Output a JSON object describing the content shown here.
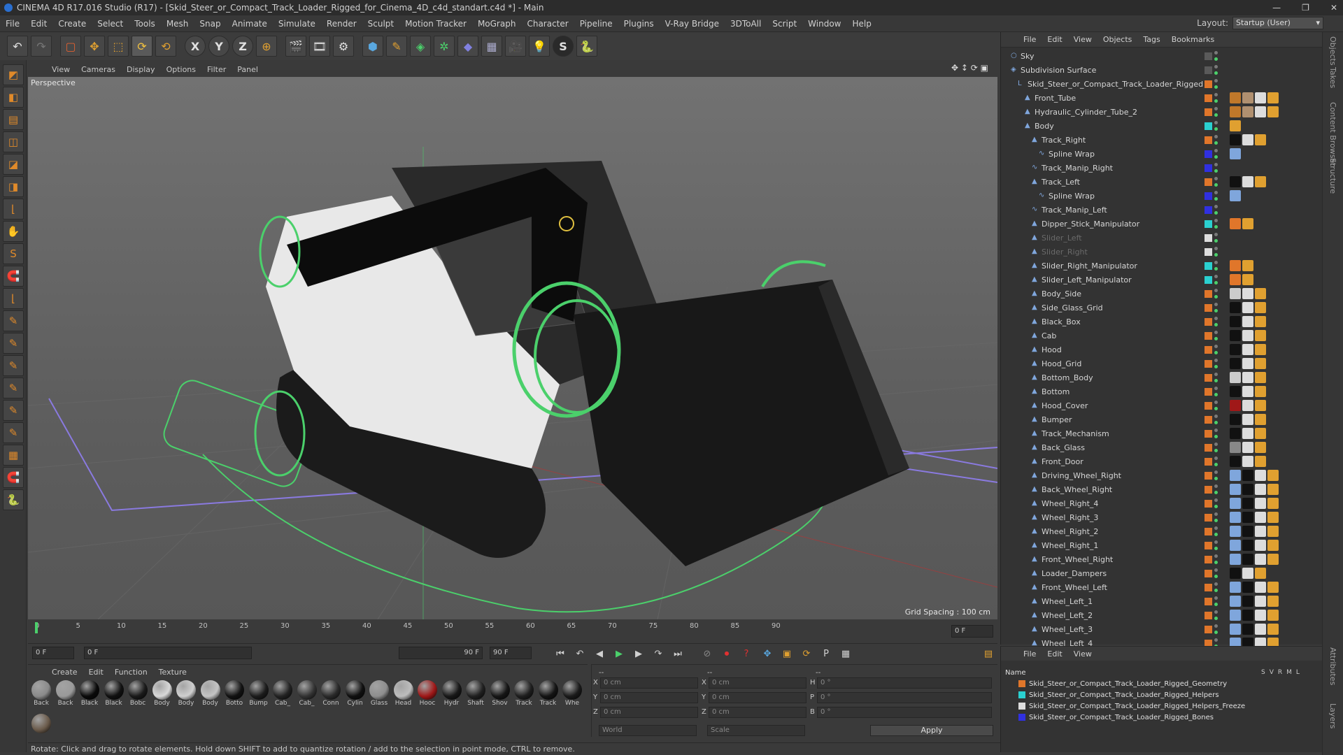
{
  "window": {
    "title": "CINEMA 4D R17.016 Studio (R17) - [Skid_Steer_or_Compact_Track_Loader_Rigged_for_Cinema_4D_c4d_standart.c4d *] - Main",
    "min": "—",
    "max": "❐",
    "close": "✕"
  },
  "menubar": [
    "File",
    "Edit",
    "Create",
    "Select",
    "Tools",
    "Mesh",
    "Snap",
    "Animate",
    "Simulate",
    "Render",
    "Sculpt",
    "Motion Tracker",
    "MoGraph",
    "Character",
    "Pipeline",
    "Plugins",
    "V-Ray Bridge",
    "3DToAll",
    "Script",
    "Window",
    "Help"
  ],
  "layout": {
    "label": "Layout:",
    "value": "Startup (User)"
  },
  "toolbar": {
    "undo": "↶",
    "redo": "↷",
    "live_select": "▢",
    "move": "✥",
    "scale": "⬚",
    "rotate": "⟳",
    "recent": "⟲",
    "x_axis": "X",
    "y_axis": "Y",
    "z_axis": "Z",
    "world": "⊕",
    "render_view": "🎬",
    "render_pv": "🎞",
    "render_settings": "⚙",
    "cube": "⬢",
    "pen": "✎",
    "subdiv": "◈",
    "cloner": "✲",
    "deformer": "◆",
    "floor": "▦",
    "camera": "🎥",
    "light": "💡",
    "s_plugin": "S",
    "python": "🐍"
  },
  "left_tools": [
    "◩",
    "◧",
    "▤",
    "◫",
    "◪",
    "◨",
    "⌊",
    "✋",
    "S",
    "🧲",
    "⌊",
    "✎",
    "✎",
    "✎",
    "✎",
    "✎",
    "✎",
    "▦",
    "🧲",
    "🐍"
  ],
  "viewport": {
    "menu": [
      "View",
      "Cameras",
      "Display",
      "Options",
      "Filter",
      "Panel"
    ],
    "label": "Perspective",
    "grid_spacing": "Grid Spacing : 100 cm",
    "nav_icons": "✥ ↕ ⟳ ▣"
  },
  "timeline": {
    "ticks": [
      "0",
      "5",
      "10",
      "15",
      "20",
      "25",
      "30",
      "35",
      "40",
      "45",
      "50",
      "55",
      "60",
      "65",
      "70",
      "75",
      "80",
      "85",
      "90"
    ],
    "current": "0 F"
  },
  "transport": {
    "start": "0 F",
    "range_start": "0 F",
    "range_end": "90 F",
    "end": "90 F"
  },
  "material_manager": {
    "menu": [
      "Create",
      "Edit",
      "Function",
      "Texture"
    ],
    "materials": [
      {
        "name": "Back",
        "color": "#8a8a8a"
      },
      {
        "name": "Back",
        "color": "#9a9a9a"
      },
      {
        "name": "Black",
        "color": "#0a0a0a"
      },
      {
        "name": "Black",
        "color": "#111"
      },
      {
        "name": "Bobc",
        "color": "#1a1a1a"
      },
      {
        "name": "Body",
        "color": "#d8d8d8"
      },
      {
        "name": "Body",
        "color": "#cfcfcf"
      },
      {
        "name": "Body",
        "color": "#c4c4c4"
      },
      {
        "name": "Botto",
        "color": "#121212"
      },
      {
        "name": "Bump",
        "color": "#1c1c1c"
      },
      {
        "name": "Cab_",
        "color": "#222"
      },
      {
        "name": "Cab_",
        "color": "#333"
      },
      {
        "name": "Conn",
        "color": "#2a2a2a"
      },
      {
        "name": "Cylin",
        "color": "#101010"
      },
      {
        "name": "Glass",
        "color": "#8e8e8e"
      },
      {
        "name": "Head",
        "color": "#bdbdbd"
      },
      {
        "name": "Hooc",
        "color": "#a01818"
      },
      {
        "name": "Hydr",
        "color": "#181818"
      },
      {
        "name": "Shaft",
        "color": "#202020"
      },
      {
        "name": "Shov",
        "color": "#161616"
      },
      {
        "name": "Track",
        "color": "#1e1e1e"
      },
      {
        "name": "Track",
        "color": "#141414"
      },
      {
        "name": "Whe",
        "color": "#1a1a1a"
      }
    ],
    "extra_material": {
      "name": "",
      "color": "#6a5a4a"
    }
  },
  "coords": {
    "header_dashes": [
      "--",
      "--",
      "--"
    ],
    "rows": [
      {
        "axis": "X",
        "pos": "0 cm",
        "axis2": "X",
        "size": "0 cm",
        "rot_axis": "H",
        "rot": "0 °"
      },
      {
        "axis": "Y",
        "pos": "0 cm",
        "axis2": "Y",
        "size": "0 cm",
        "rot_axis": "P",
        "rot": "0 °"
      },
      {
        "axis": "Z",
        "pos": "0 cm",
        "axis2": "Z",
        "size": "0 cm",
        "rot_axis": "B",
        "rot": "0 °"
      }
    ],
    "mode1": "World",
    "mode2": "Scale",
    "apply": "Apply"
  },
  "status": "Rotate: Click and drag to rotate elements. Hold down SHIFT to add to quantize rotation / add to the selection in point mode, CTRL to remove.",
  "object_manager": {
    "menu": [
      "File",
      "Edit",
      "View",
      "Objects",
      "Tags",
      "Bookmarks"
    ],
    "objects": [
      {
        "name": "Sky",
        "indent": 0,
        "icon": "○",
        "layer": "#5a5a5a",
        "dim": false,
        "tags": []
      },
      {
        "name": "Subdivision Surface",
        "indent": 0,
        "icon": "◈",
        "layer": "#5a5a5a",
        "dim": false,
        "tags": []
      },
      {
        "name": "Skid_Steer_or_Compact_Track_Loader_Rigged",
        "indent": 1,
        "icon": "L",
        "layer": "#e0762a",
        "dim": false,
        "tags": []
      },
      {
        "name": "Front_Tube",
        "indent": 2,
        "icon": "▲",
        "layer": "#e0762a",
        "dim": false,
        "tags": [
          "#c0782a",
          "#b09070",
          "#ddd",
          "#e0a030"
        ]
      },
      {
        "name": "Hydraulic_Cylinder_Tube_2",
        "indent": 2,
        "icon": "▲",
        "layer": "#e0762a",
        "dim": false,
        "tags": [
          "#c0782a",
          "#b09070",
          "#ddd",
          "#e0a030"
        ]
      },
      {
        "name": "Body",
        "indent": 2,
        "icon": "▲",
        "layer": "#2ad0d0",
        "dim": false,
        "tags": [
          "#e0a030"
        ]
      },
      {
        "name": "Track_Right",
        "indent": 3,
        "icon": "▲",
        "layer": "#e0762a",
        "dim": false,
        "tags": [
          "#111",
          "#ddd",
          "#e0a030"
        ]
      },
      {
        "name": "Spline Wrap",
        "indent": 4,
        "icon": "∿",
        "layer": "#3030e0",
        "dim": false,
        "tags": [
          "#7fa6dc"
        ]
      },
      {
        "name": "Track_Manip_Right",
        "indent": 3,
        "icon": "∿",
        "layer": "#3030e0",
        "dim": false,
        "tags": []
      },
      {
        "name": "Track_Left",
        "indent": 3,
        "icon": "▲",
        "layer": "#e0762a",
        "dim": false,
        "tags": [
          "#111",
          "#ddd",
          "#e0a030"
        ]
      },
      {
        "name": "Spline Wrap",
        "indent": 4,
        "icon": "∿",
        "layer": "#3030e0",
        "dim": false,
        "tags": [
          "#7fa6dc"
        ]
      },
      {
        "name": "Track_Manip_Left",
        "indent": 3,
        "icon": "∿",
        "layer": "#3030e0",
        "dim": false,
        "tags": []
      },
      {
        "name": "Dipper_Stick_Manipulator",
        "indent": 3,
        "icon": "▲",
        "layer": "#2ad0d0",
        "dim": false,
        "tags": [
          "#e0762a",
          "#e0a030"
        ]
      },
      {
        "name": "Slider_Left",
        "indent": 3,
        "icon": "▲",
        "layer": "#ddd",
        "dim": true,
        "tags": []
      },
      {
        "name": "Slider_Right",
        "indent": 3,
        "icon": "▲",
        "layer": "#ddd",
        "dim": true,
        "tags": []
      },
      {
        "name": "Slider_Right_Manipulator",
        "indent": 3,
        "icon": "▲",
        "layer": "#2ad0d0",
        "dim": false,
        "tags": [
          "#e0762a",
          "#e0a030"
        ]
      },
      {
        "name": "Slider_Left_Manipulator",
        "indent": 3,
        "icon": "▲",
        "layer": "#2ad0d0",
        "dim": false,
        "tags": [
          "#e0762a",
          "#e0a030"
        ]
      },
      {
        "name": "Body_Side",
        "indent": 3,
        "icon": "▲",
        "layer": "#e0762a",
        "dim": false,
        "tags": [
          "#ccc",
          "#ddd",
          "#e0a030"
        ]
      },
      {
        "name": "Side_Glass_Grid",
        "indent": 3,
        "icon": "▲",
        "layer": "#e0762a",
        "dim": false,
        "tags": [
          "#111",
          "#ddd",
          "#e0a030"
        ]
      },
      {
        "name": "Black_Box",
        "indent": 3,
        "icon": "▲",
        "layer": "#e0762a",
        "dim": false,
        "tags": [
          "#111",
          "#ddd",
          "#e0a030"
        ]
      },
      {
        "name": "Cab",
        "indent": 3,
        "icon": "▲",
        "layer": "#e0762a",
        "dim": false,
        "tags": [
          "#111",
          "#ddd",
          "#e0a030"
        ]
      },
      {
        "name": "Hood",
        "indent": 3,
        "icon": "▲",
        "layer": "#e0762a",
        "dim": false,
        "tags": [
          "#111",
          "#ddd",
          "#e0a030"
        ]
      },
      {
        "name": "Hood_Grid",
        "indent": 3,
        "icon": "▲",
        "layer": "#e0762a",
        "dim": false,
        "tags": [
          "#111",
          "#ddd",
          "#e0a030"
        ]
      },
      {
        "name": "Bottom_Body",
        "indent": 3,
        "icon": "▲",
        "layer": "#e0762a",
        "dim": false,
        "tags": [
          "#ccc",
          "#ddd",
          "#e0a030"
        ]
      },
      {
        "name": "Bottom",
        "indent": 3,
        "icon": "▲",
        "layer": "#e0762a",
        "dim": false,
        "tags": [
          "#111",
          "#ddd",
          "#e0a030"
        ]
      },
      {
        "name": "Hood_Cover",
        "indent": 3,
        "icon": "▲",
        "layer": "#e0762a",
        "dim": false,
        "tags": [
          "#a01818",
          "#ddd",
          "#e0a030"
        ]
      },
      {
        "name": "Bumper",
        "indent": 3,
        "icon": "▲",
        "layer": "#e0762a",
        "dim": false,
        "tags": [
          "#111",
          "#ddd",
          "#e0a030"
        ]
      },
      {
        "name": "Track_Mechanism",
        "indent": 3,
        "icon": "▲",
        "layer": "#e0762a",
        "dim": false,
        "tags": [
          "#111",
          "#ddd",
          "#e0a030"
        ]
      },
      {
        "name": "Back_Glass",
        "indent": 3,
        "icon": "▲",
        "layer": "#e0762a",
        "dim": false,
        "tags": [
          "#888",
          "#ddd",
          "#e0a030"
        ]
      },
      {
        "name": "Front_Door",
        "indent": 3,
        "icon": "▲",
        "layer": "#e0762a",
        "dim": false,
        "tags": [
          "#111",
          "#ddd",
          "#e0a030"
        ]
      },
      {
        "name": "Driving_Wheel_Right",
        "indent": 3,
        "icon": "▲",
        "layer": "#e0762a",
        "dim": false,
        "tags": [
          "#7fa6dc",
          "#111",
          "#ddd",
          "#e0a030"
        ]
      },
      {
        "name": "Back_Wheel_Right",
        "indent": 3,
        "icon": "▲",
        "layer": "#e0762a",
        "dim": false,
        "tags": [
          "#7fa6dc",
          "#111",
          "#ddd",
          "#e0a030"
        ]
      },
      {
        "name": "Wheel_Right_4",
        "indent": 3,
        "icon": "▲",
        "layer": "#e0762a",
        "dim": false,
        "tags": [
          "#7fa6dc",
          "#111",
          "#ddd",
          "#e0a030"
        ]
      },
      {
        "name": "Wheel_Right_3",
        "indent": 3,
        "icon": "▲",
        "layer": "#e0762a",
        "dim": false,
        "tags": [
          "#7fa6dc",
          "#111",
          "#ddd",
          "#e0a030"
        ]
      },
      {
        "name": "Wheel_Right_2",
        "indent": 3,
        "icon": "▲",
        "layer": "#e0762a",
        "dim": false,
        "tags": [
          "#7fa6dc",
          "#111",
          "#ddd",
          "#e0a030"
        ]
      },
      {
        "name": "Wheel_Right_1",
        "indent": 3,
        "icon": "▲",
        "layer": "#e0762a",
        "dim": false,
        "tags": [
          "#7fa6dc",
          "#111",
          "#ddd",
          "#e0a030"
        ]
      },
      {
        "name": "Front_Wheel_Right",
        "indent": 3,
        "icon": "▲",
        "layer": "#e0762a",
        "dim": false,
        "tags": [
          "#7fa6dc",
          "#111",
          "#ddd",
          "#e0a030"
        ]
      },
      {
        "name": "Loader_Dampers",
        "indent": 3,
        "icon": "▲",
        "layer": "#e0762a",
        "dim": false,
        "tags": [
          "#111",
          "#ddd",
          "#e0a030"
        ]
      },
      {
        "name": "Front_Wheel_Left",
        "indent": 3,
        "icon": "▲",
        "layer": "#e0762a",
        "dim": false,
        "tags": [
          "#7fa6dc",
          "#111",
          "#ddd",
          "#e0a030"
        ]
      },
      {
        "name": "Wheel_Left_1",
        "indent": 3,
        "icon": "▲",
        "layer": "#e0762a",
        "dim": false,
        "tags": [
          "#7fa6dc",
          "#111",
          "#ddd",
          "#e0a030"
        ]
      },
      {
        "name": "Wheel_Left_2",
        "indent": 3,
        "icon": "▲",
        "layer": "#e0762a",
        "dim": false,
        "tags": [
          "#7fa6dc",
          "#111",
          "#ddd",
          "#e0a030"
        ]
      },
      {
        "name": "Wheel_Left_3",
        "indent": 3,
        "icon": "▲",
        "layer": "#e0762a",
        "dim": false,
        "tags": [
          "#7fa6dc",
          "#111",
          "#ddd",
          "#e0a030"
        ]
      },
      {
        "name": "Wheel_Left_4",
        "indent": 3,
        "icon": "▲",
        "layer": "#e0762a",
        "dim": false,
        "tags": [
          "#7fa6dc",
          "#111",
          "#ddd",
          "#e0a030"
        ]
      }
    ]
  },
  "right_tabs": [
    "Objects",
    "Takes",
    "Content Browser",
    "Structure",
    "Attributes",
    "Layers"
  ],
  "layer_manager": {
    "menu": [
      "File",
      "Edit",
      "View"
    ],
    "header": {
      "name": "Name",
      "cols": [
        "S",
        "V",
        "R",
        "M",
        "L"
      ]
    },
    "layers": [
      {
        "name": "Skid_Steer_or_Compact_Track_Loader_Rigged_Geometry",
        "color": "#e0762a"
      },
      {
        "name": "Skid_Steer_or_Compact_Track_Loader_Rigged_Helpers",
        "color": "#2ad0d0"
      },
      {
        "name": "Skid_Steer_or_Compact_Track_Loader_Rigged_Helpers_Freeze",
        "color": "#dddddd"
      },
      {
        "name": "Skid_Steer_or_Compact_Track_Loader_Rigged_Bones",
        "color": "#3030e0"
      }
    ]
  }
}
